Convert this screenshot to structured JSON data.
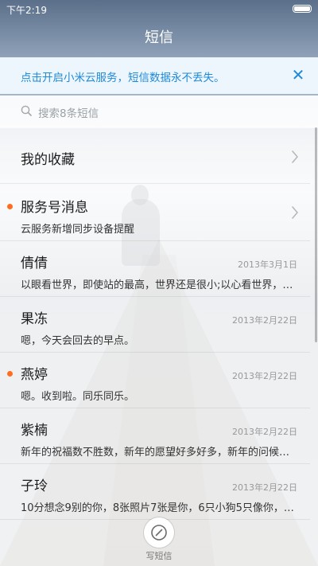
{
  "status_bar": {
    "time": "下午2:19"
  },
  "header": {
    "title": "短信"
  },
  "banner": {
    "text": "点击开启小米云服务，短信数据永不丢失。",
    "close_icon": "close-icon"
  },
  "search": {
    "placeholder": "搜索8条短信"
  },
  "conversations": [
    {
      "title": "我的收藏",
      "subtitle": "",
      "time": "",
      "unread": false,
      "chevron": true
    },
    {
      "title": "服务号消息",
      "subtitle": "云服务新增同步设备提醒",
      "time": "",
      "unread": true,
      "chevron": true
    },
    {
      "title": "倩倩",
      "subtitle": "以眼看世界，即使站的最高，世界还是很小;以心看世界，…",
      "time": "2013年3月1日",
      "unread": false,
      "chevron": false
    },
    {
      "title": "果冻",
      "subtitle": "嗯，今天会回去的早点。",
      "time": "2013年2月22日",
      "unread": false,
      "chevron": false
    },
    {
      "title": "燕婷",
      "subtitle": "嗯。收到啦。同乐同乐。",
      "time": "2013年2月22日",
      "unread": true,
      "chevron": false
    },
    {
      "title": "紫楠",
      "subtitle": "新年的祝福数不胜数，新年的愿望好多好多，新年的问候…",
      "time": "2013年2月22日",
      "unread": false,
      "chevron": false
    },
    {
      "title": "子玲",
      "subtitle": "10分想念9别的你，8张照片7张是你，6只小狗5只像你，4…",
      "time": "2013年2月22日",
      "unread": false,
      "chevron": false
    }
  ],
  "compose": {
    "label": "写短信"
  },
  "colors": {
    "accent": "#1e8ad8",
    "unread_dot": "#ff6d1f"
  }
}
